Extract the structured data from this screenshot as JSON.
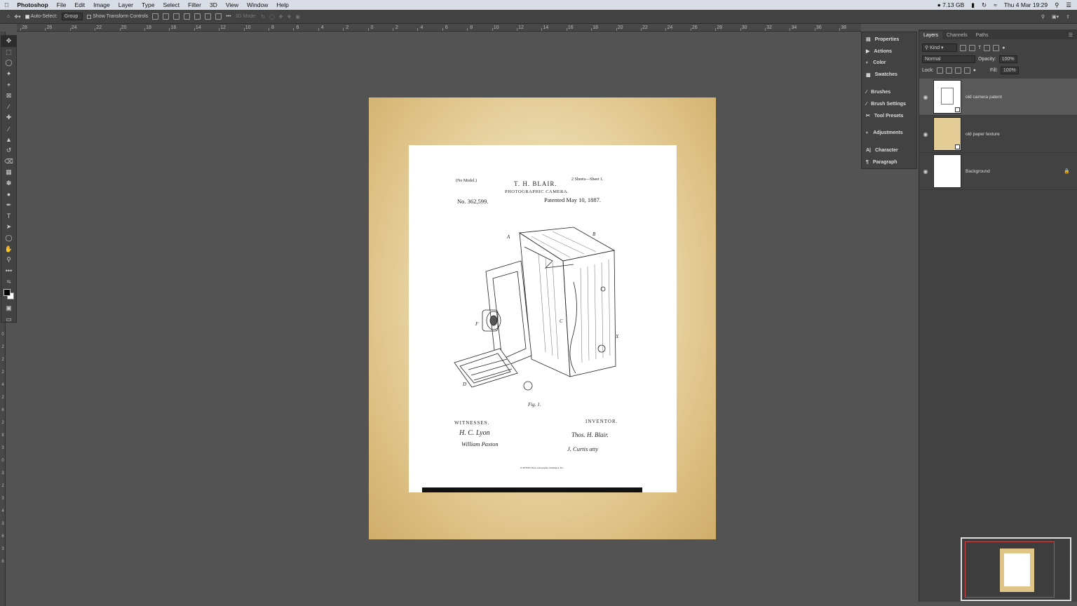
{
  "menubar": {
    "app_name": "Photoshop",
    "items": [
      "File",
      "Edit",
      "Image",
      "Layer",
      "Type",
      "Select",
      "Filter",
      "3D",
      "View",
      "Window",
      "Help"
    ],
    "memory": "7.13 GB",
    "datetime": "Thu 4 Mar 19:29"
  },
  "options_bar": {
    "auto_select_label": "Auto-Select:",
    "auto_select_mode": "Group",
    "transform_label": "Show Transform Controls",
    "mode_3d_label": "3D Mode:"
  },
  "ruler": {
    "top_ticks": [
      "28",
      "26",
      "24",
      "22",
      "20",
      "18",
      "16",
      "14",
      "12",
      "10",
      "8",
      "6",
      "4",
      "2",
      "0",
      "2",
      "4",
      "6",
      "8",
      "10",
      "12",
      "14",
      "16",
      "18",
      "20",
      "22",
      "24",
      "26",
      "28",
      "30",
      "32",
      "34",
      "36",
      "38"
    ],
    "left_ticks": [
      "1",
      "8",
      "2",
      "0",
      "2",
      "2",
      "2",
      "4",
      "2",
      "6",
      "2",
      "8",
      "3",
      "0",
      "3",
      "2",
      "3",
      "4",
      "3",
      "6",
      "3",
      "8"
    ]
  },
  "patent": {
    "no_model": "(No Model.)",
    "sheets": "2 Sheets—Sheet 1.",
    "inventor_name": "T. H. BLAIR.",
    "title": "PHOTOGRAPHIC CAMERA.",
    "number": "No. 362,599.",
    "date": "Patented May 10, 1887.",
    "fig": "Fig. 1.",
    "witnesses_label": "WITNESSES.",
    "inventor_label": "INVENTOR.",
    "witness1": "H. C. Lyon",
    "witness2": "William Paxton",
    "inventor_sig": "Thos. H. Blair.",
    "attorney_sig": "J. Curtis atty",
    "printer": "N. PETERS, Photo-Lithographer, Washington, D.C."
  },
  "collapsed_panels": [
    {
      "label": "Properties",
      "icon": "properties-icon"
    },
    {
      "label": "Actions",
      "icon": "actions-icon"
    },
    {
      "label": "Color",
      "icon": "color-icon"
    },
    {
      "label": "Swatches",
      "icon": "swatches-icon"
    },
    {
      "label": "Brushes",
      "icon": "brushes-icon"
    },
    {
      "label": "Brush Settings",
      "icon": "brush-settings-icon"
    },
    {
      "label": "Tool Presets",
      "icon": "tool-presets-icon"
    },
    {
      "label": "Adjustments",
      "icon": "adjustments-icon"
    },
    {
      "label": "Character",
      "icon": "character-icon"
    },
    {
      "label": "Paragraph",
      "icon": "paragraph-icon"
    }
  ],
  "layers_panel": {
    "tabs": [
      "Layers",
      "Channels",
      "Paths"
    ],
    "filter_kind": "Kind",
    "blend_mode": "Normal",
    "opacity_label": "Opacity:",
    "opacity": "100%",
    "lock_label": "Lock:",
    "fill_label": "Fill:",
    "fill": "100%",
    "layers": [
      {
        "name": "old camera patent",
        "selected": true,
        "locked": false
      },
      {
        "name": "old paper texture",
        "selected": false,
        "locked": false
      },
      {
        "name": "Background",
        "selected": false,
        "locked": true
      }
    ]
  }
}
